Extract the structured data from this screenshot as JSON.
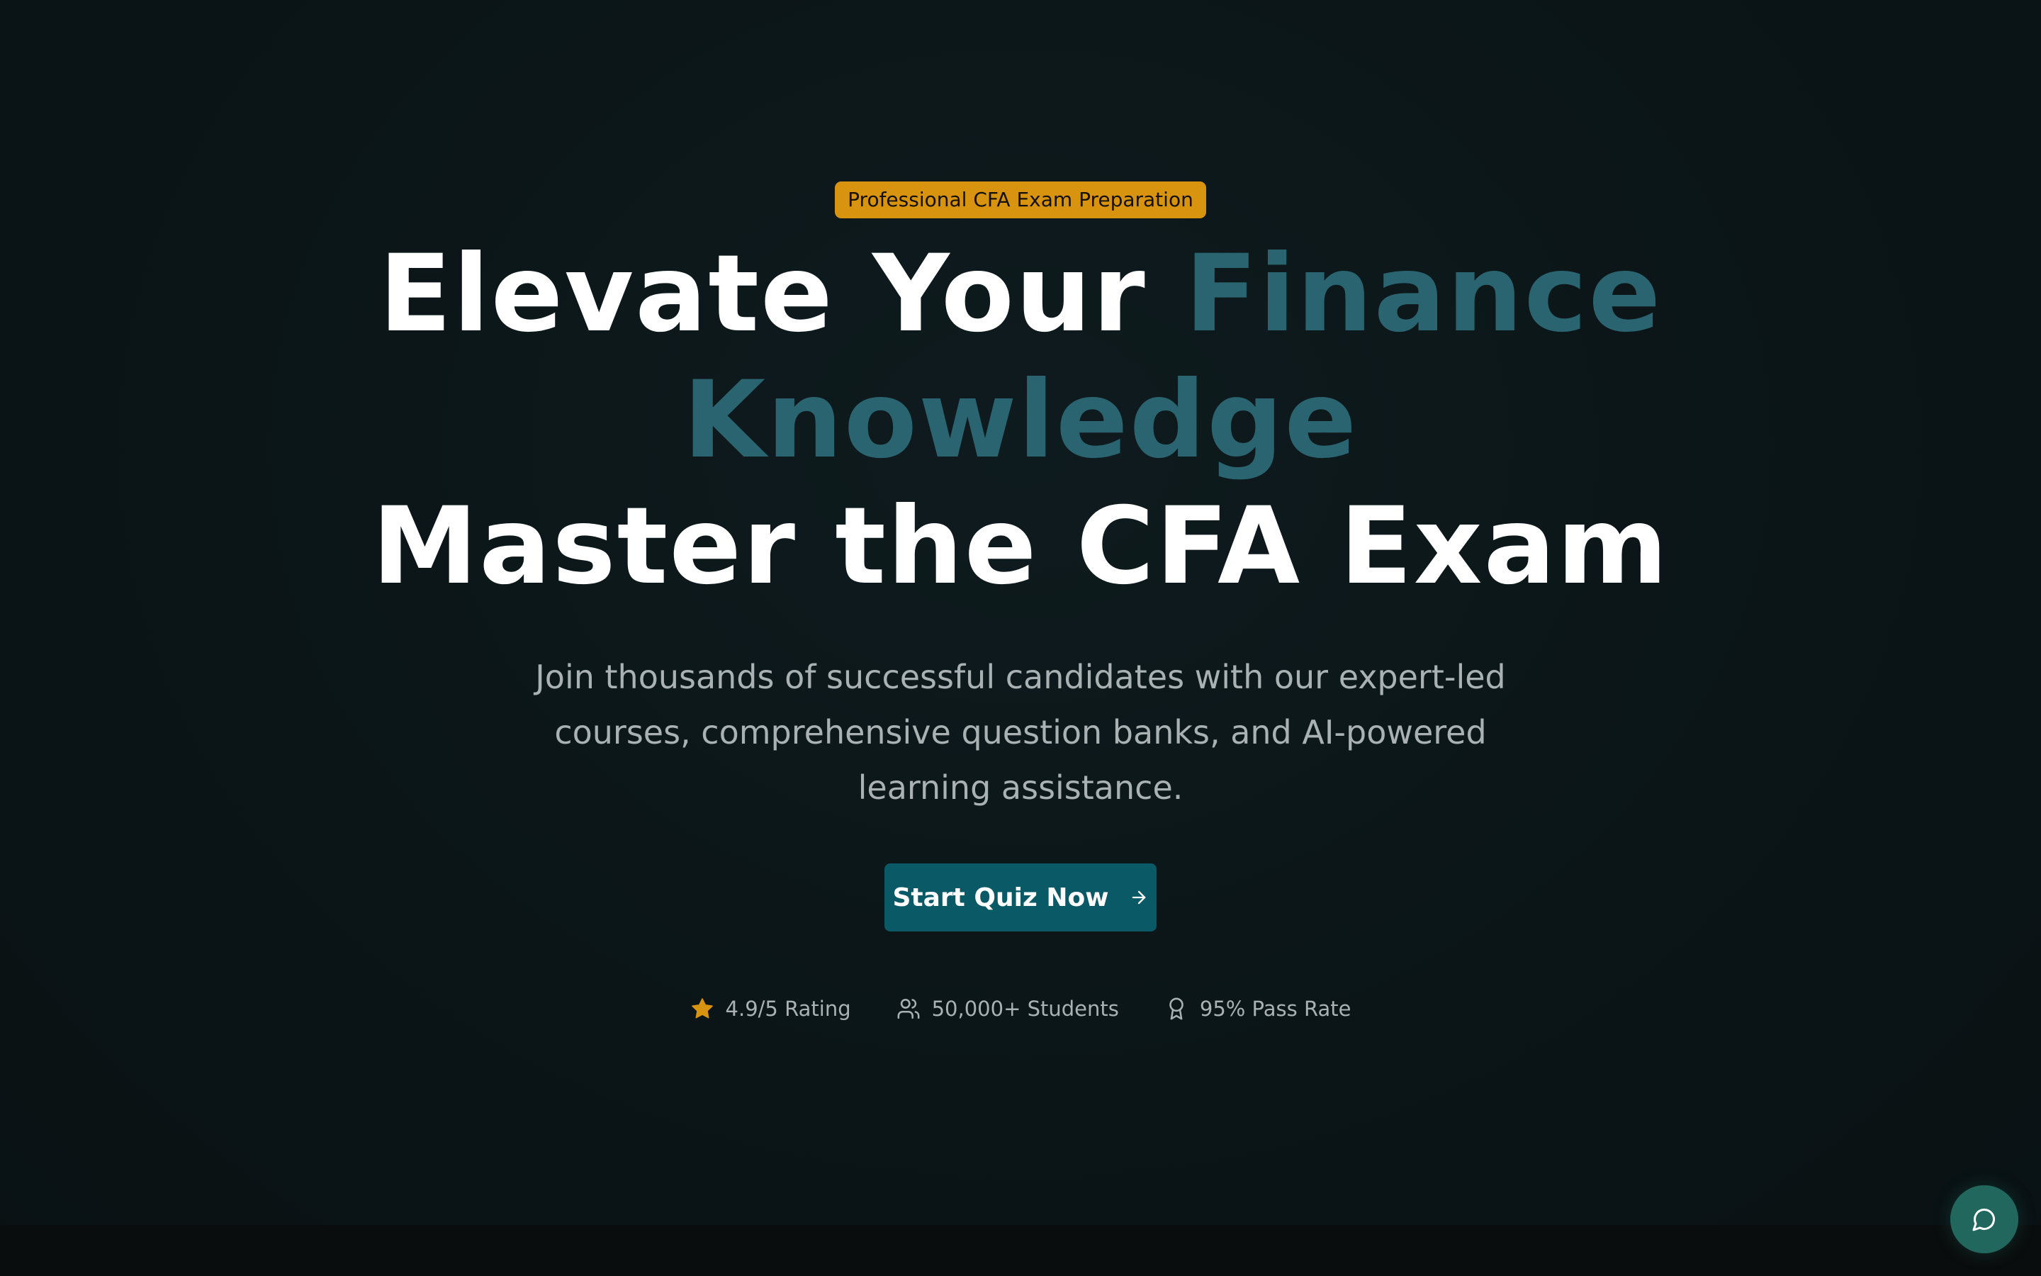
{
  "hero": {
    "badge": "Professional CFA Exam Preparation",
    "headline": {
      "part1": "Elevate Your ",
      "accent_line1": "Finance",
      "accent_line2": "Knowledge",
      "line3": "Master the CFA Exam"
    },
    "subtitle": "Join thousands of successful candidates with our expert-led courses, comprehensive question banks, and AI-powered learning assistance.",
    "cta": {
      "label": "Start Quiz Now",
      "icon": "arrow-right-icon"
    }
  },
  "stats": [
    {
      "icon": "star-icon",
      "label": "4.9/5 Rating"
    },
    {
      "icon": "users-icon",
      "label": "50,000+ Students"
    },
    {
      "icon": "award-icon",
      "label": "95% Pass Rate"
    }
  ],
  "chat_widget": {
    "icon": "chat-bubble-icon"
  },
  "colors": {
    "background": "#0b1416",
    "badge": "#d9940f",
    "accent_text": "#2a6470",
    "cta": "#0a5966",
    "chat_button": "#21675e",
    "star": "#d9940f"
  }
}
